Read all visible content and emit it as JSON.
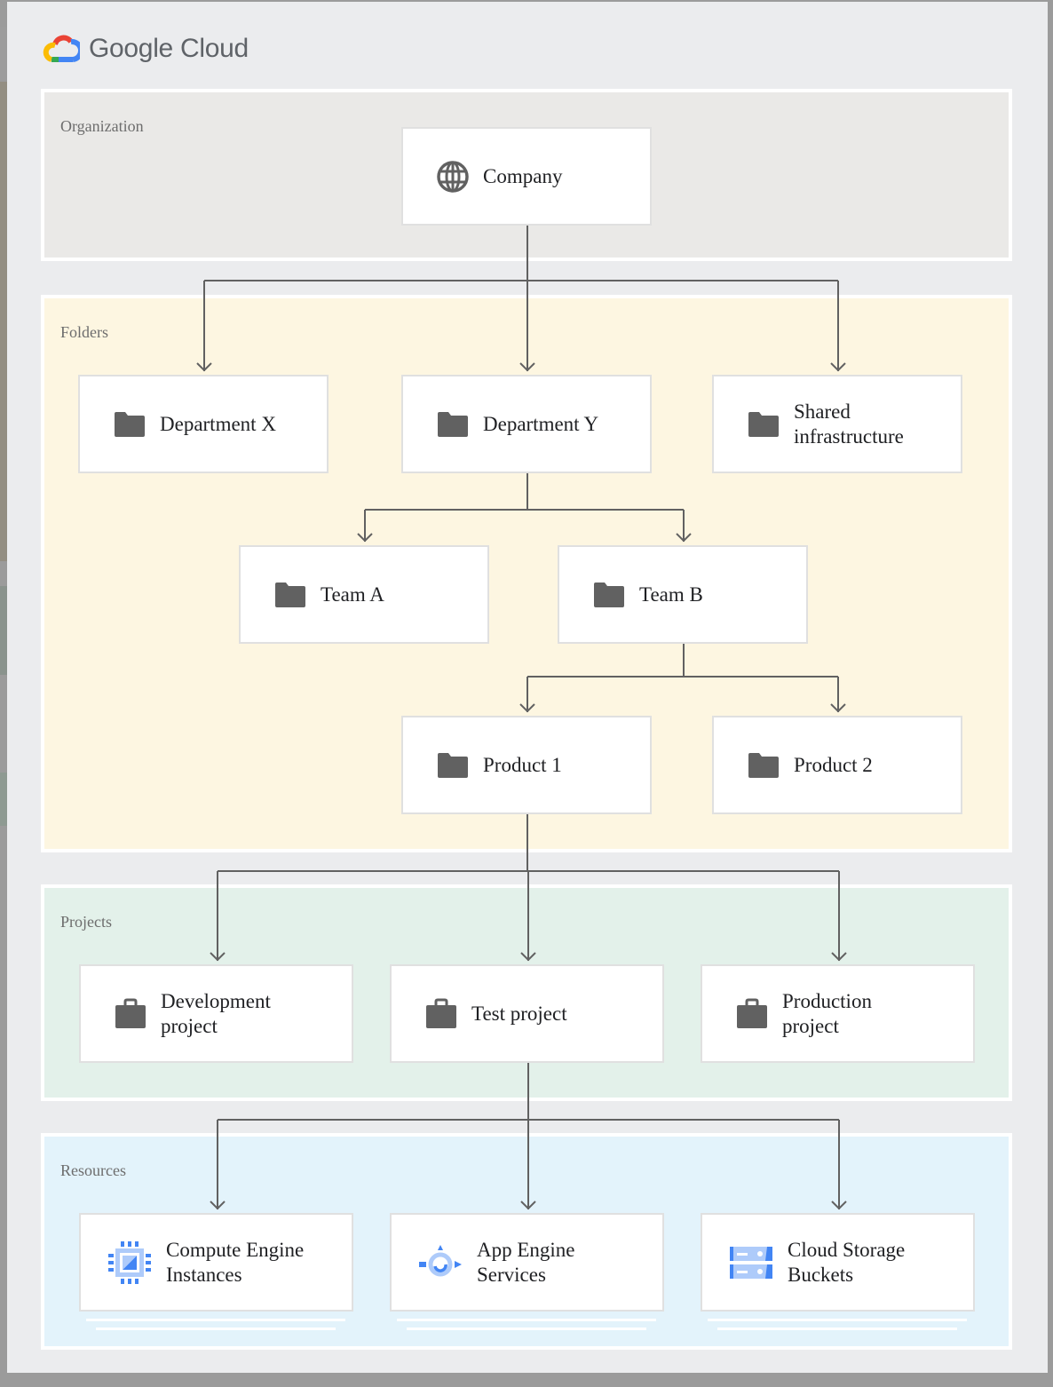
{
  "brand": {
    "name": "Google Cloud",
    "logo_colors": {
      "red": "#ea4335",
      "yellow": "#fbbc04",
      "green": "#34a853",
      "blue": "#4285f4"
    }
  },
  "colors": {
    "organization_band": "#eae9e7",
    "folders_band": "#fdf6e1",
    "projects_band": "#e3f1ea",
    "resources_band": "#e3f3fb",
    "icon_gray": "#616161",
    "product_icon_blue": "#4285f4",
    "product_icon_light_blue": "#aecbfa",
    "connector": "#616161"
  },
  "bands": {
    "organization": {
      "label": "Organization"
    },
    "folders": {
      "label": "Folders"
    },
    "projects": {
      "label": "Projects"
    },
    "resources": {
      "label": "Resources"
    }
  },
  "nodes": {
    "company": {
      "lines": [
        "Company"
      ],
      "icon": "globe-icon"
    },
    "department_x": {
      "lines": [
        "Department X"
      ],
      "icon": "folder-icon"
    },
    "department_y": {
      "lines": [
        "Department Y"
      ],
      "icon": "folder-icon"
    },
    "shared_infrastructure": {
      "lines": [
        "Shared",
        "infrastructure"
      ],
      "icon": "folder-icon"
    },
    "team_a": {
      "lines": [
        "Team A"
      ],
      "icon": "folder-icon"
    },
    "team_b": {
      "lines": [
        "Team B"
      ],
      "icon": "folder-icon"
    },
    "product_1": {
      "lines": [
        "Product 1"
      ],
      "icon": "folder-icon"
    },
    "product_2": {
      "lines": [
        "Product 2"
      ],
      "icon": "folder-icon"
    },
    "development_project": {
      "lines": [
        "Development",
        "project"
      ],
      "icon": "briefcase-icon"
    },
    "test_project": {
      "lines": [
        "Test project"
      ],
      "icon": "briefcase-icon"
    },
    "production_project": {
      "lines": [
        "Production",
        "project"
      ],
      "icon": "briefcase-icon"
    },
    "compute_engine": {
      "lines": [
        "Compute Engine",
        "Instances"
      ],
      "icon": "compute-engine-icon"
    },
    "app_engine": {
      "lines": [
        "App Engine",
        "Services"
      ],
      "icon": "app-engine-icon"
    },
    "cloud_storage": {
      "lines": [
        "Cloud Storage",
        "Buckets"
      ],
      "icon": "cloud-storage-icon"
    }
  },
  "edges": [
    [
      "company",
      "department_x"
    ],
    [
      "company",
      "department_y"
    ],
    [
      "company",
      "shared_infrastructure"
    ],
    [
      "department_y",
      "team_a"
    ],
    [
      "department_y",
      "team_b"
    ],
    [
      "team_b",
      "product_1"
    ],
    [
      "team_b",
      "product_2"
    ],
    [
      "product_1",
      "development_project"
    ],
    [
      "product_1",
      "test_project"
    ],
    [
      "product_1",
      "production_project"
    ],
    [
      "test_project",
      "compute_engine"
    ],
    [
      "test_project",
      "app_engine"
    ],
    [
      "test_project",
      "cloud_storage"
    ]
  ]
}
